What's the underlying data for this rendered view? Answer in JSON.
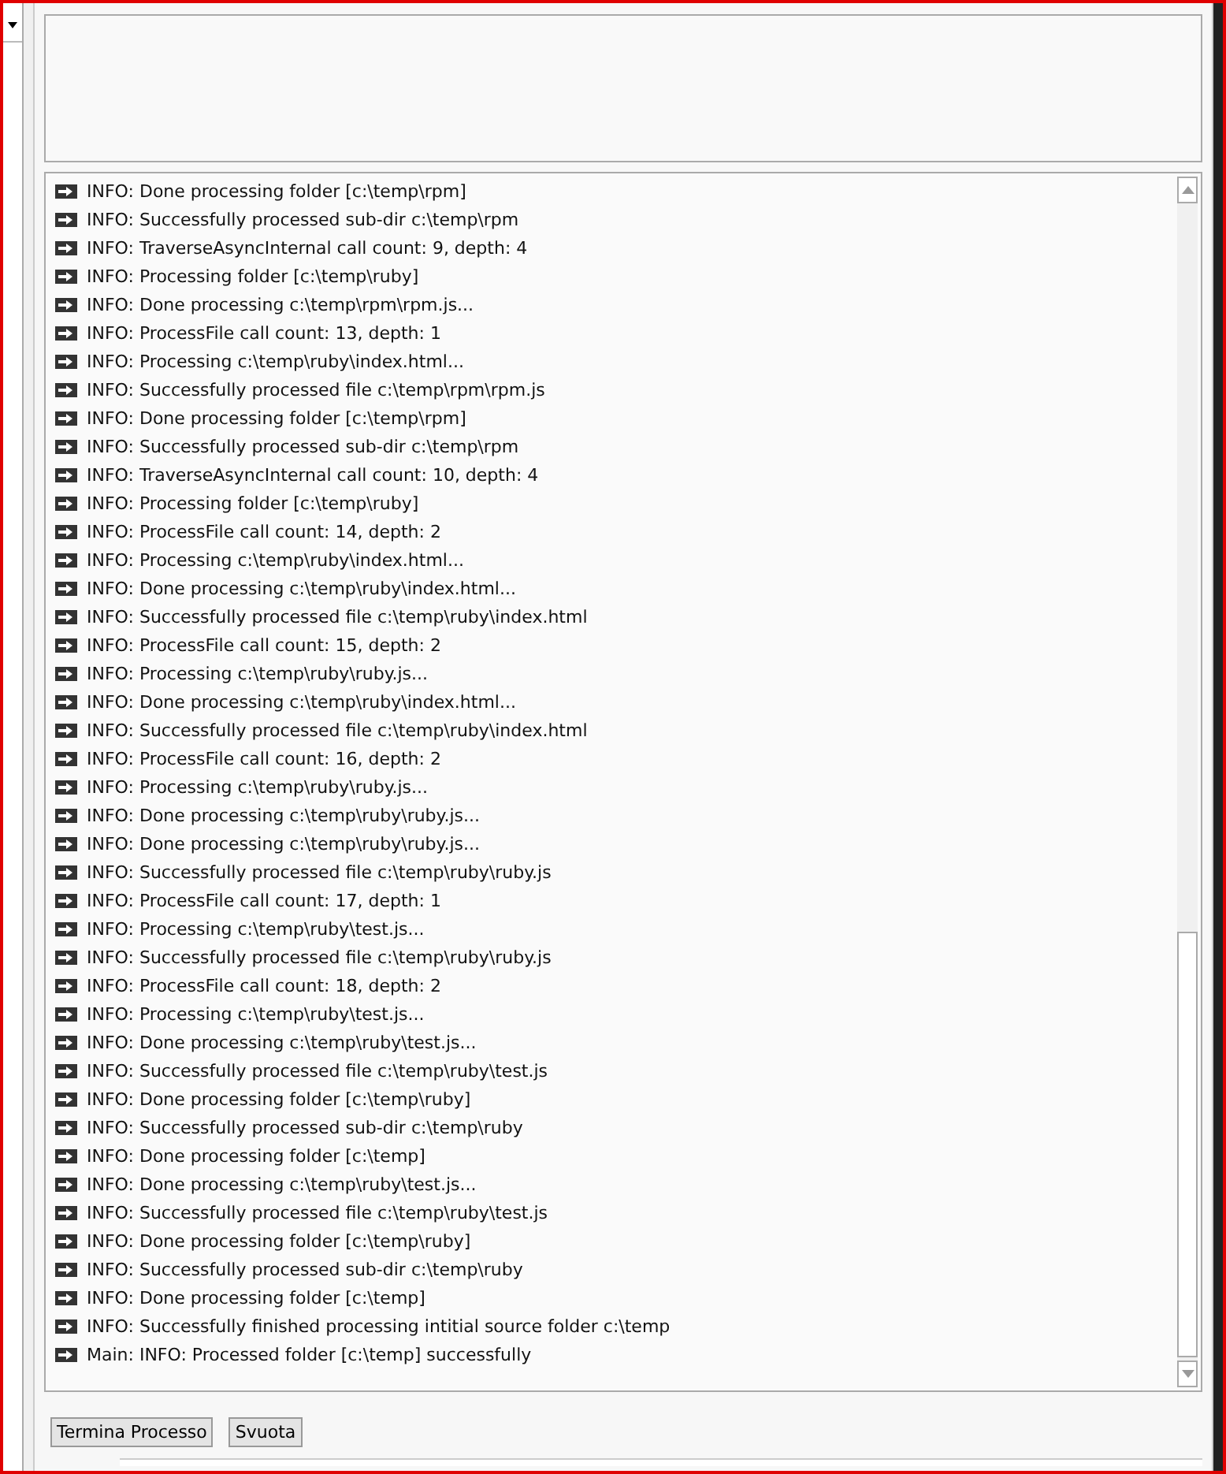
{
  "log": [
    "INFO: Done processing folder [c:\\temp\\rpm]",
    "INFO: Successfully processed sub-dir c:\\temp\\rpm",
    "INFO: TraverseAsyncInternal call count: 9, depth: 4",
    "INFO: Processing folder [c:\\temp\\ruby]",
    "INFO: Done processing c:\\temp\\rpm\\rpm.js...",
    "INFO: ProcessFile call count: 13, depth: 1",
    "INFO: Processing c:\\temp\\ruby\\index.html...",
    "INFO: Successfully processed file c:\\temp\\rpm\\rpm.js",
    "INFO: Done processing folder [c:\\temp\\rpm]",
    "INFO: Successfully processed sub-dir c:\\temp\\rpm",
    "INFO: TraverseAsyncInternal call count: 10, depth: 4",
    "INFO: Processing folder [c:\\temp\\ruby]",
    "INFO: ProcessFile call count: 14, depth: 2",
    "INFO: Processing c:\\temp\\ruby\\index.html...",
    "INFO: Done processing c:\\temp\\ruby\\index.html...",
    "INFO: Successfully processed file c:\\temp\\ruby\\index.html",
    "INFO: ProcessFile call count: 15, depth: 2",
    "INFO: Processing c:\\temp\\ruby\\ruby.js...",
    "INFO: Done processing c:\\temp\\ruby\\index.html...",
    "INFO: Successfully processed file c:\\temp\\ruby\\index.html",
    "INFO: ProcessFile call count: 16, depth: 2",
    "INFO: Processing c:\\temp\\ruby\\ruby.js...",
    "INFO: Done processing c:\\temp\\ruby\\ruby.js...",
    "INFO: Done processing c:\\temp\\ruby\\ruby.js...",
    "INFO: Successfully processed file c:\\temp\\ruby\\ruby.js",
    "INFO: ProcessFile call count: 17, depth: 1",
    "INFO: Processing c:\\temp\\ruby\\test.js...",
    "INFO: Successfully processed file c:\\temp\\ruby\\ruby.js",
    "INFO: ProcessFile call count: 18, depth: 2",
    "INFO: Processing c:\\temp\\ruby\\test.js...",
    "INFO: Done processing c:\\temp\\ruby\\test.js...",
    "INFO: Successfully processed file c:\\temp\\ruby\\test.js",
    "INFO: Done processing folder [c:\\temp\\ruby]",
    "INFO: Successfully processed sub-dir c:\\temp\\ruby",
    "INFO: Done processing folder [c:\\temp]",
    "INFO: Done processing c:\\temp\\ruby\\test.js...",
    "INFO: Successfully processed file c:\\temp\\ruby\\test.js",
    "INFO: Done processing folder [c:\\temp\\ruby]",
    "INFO: Successfully processed sub-dir c:\\temp\\ruby",
    "INFO: Done processing folder [c:\\temp]",
    "INFO: Successfully finished processing intitial source folder c:\\temp",
    "Main: INFO: Processed folder [c:\\temp] successfully"
  ],
  "buttons": [
    "Termina Processo",
    "Svuota"
  ]
}
